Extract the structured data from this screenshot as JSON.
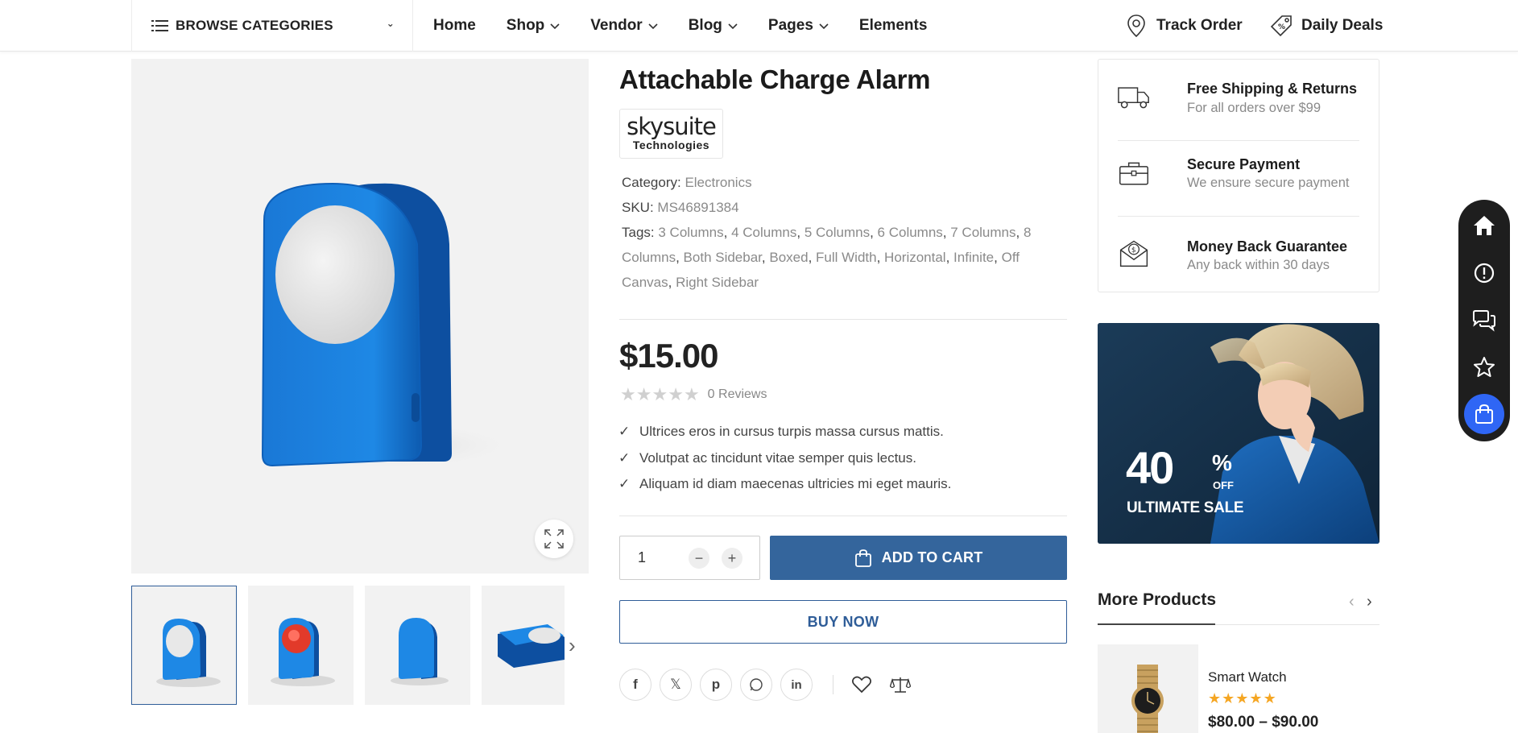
{
  "header": {
    "browse_label": "BROWSE CATEGORIES",
    "nav": [
      {
        "label": "Home",
        "dropdown": false
      },
      {
        "label": "Shop",
        "dropdown": true
      },
      {
        "label": "Vendor",
        "dropdown": true
      },
      {
        "label": "Blog",
        "dropdown": true
      },
      {
        "label": "Pages",
        "dropdown": true
      },
      {
        "label": "Elements",
        "dropdown": false
      }
    ],
    "track_order": "Track Order",
    "daily_deals": "Daily Deals"
  },
  "product": {
    "title": "Attachable Charge Alarm",
    "brand_line1": "skysuite",
    "brand_line2": "Technologies",
    "category_label": "Category:",
    "category_value": "Electronics",
    "sku_label": "SKU:",
    "sku_value": "MS46891384",
    "tags_label": "Tags:",
    "tags": [
      "3 Columns",
      "4 Columns",
      "5 Columns",
      "6 Columns",
      "7 Columns",
      "8 Columns",
      "Both Sidebar",
      "Boxed",
      "Full Width",
      "Horizontal",
      "Infinite",
      "Off Canvas",
      "Right Sidebar"
    ],
    "price": "$15.00",
    "rating": 0,
    "reviews_text": "0 Reviews",
    "features": [
      "Ultrices eros in cursus turpis massa cursus mattis.",
      "Volutpat ac tincidunt vitae semper quis lectus.",
      "Aliquam id diam maecenas ultricies mi eget mauris."
    ],
    "quantity": "1",
    "add_to_cart": "ADD TO CART",
    "buy_now": "BUY NOW"
  },
  "services": [
    {
      "title": "Free Shipping & Returns",
      "subtitle": "For all orders over $99",
      "icon": "truck-icon"
    },
    {
      "title": "Secure Payment",
      "subtitle": "We ensure secure payment",
      "icon": "briefcase-icon"
    },
    {
      "title": "Money Back Guarantee",
      "subtitle": "Any back within 30 days",
      "icon": "money-envelope-icon"
    }
  ],
  "banner": {
    "percent": "40",
    "percent_sign": "%",
    "off": "OFF",
    "sale": "ULTIMATE SALE"
  },
  "more_products": {
    "title": "More Products",
    "items": [
      {
        "name": "Smart Watch",
        "rating": 5,
        "price": "$80.00 – $90.00"
      }
    ]
  },
  "colors": {
    "accent": "#34659c",
    "float_bar": "#1e1e1e",
    "float_cart": "#2f66f5",
    "star_rated": "#f5a623"
  }
}
